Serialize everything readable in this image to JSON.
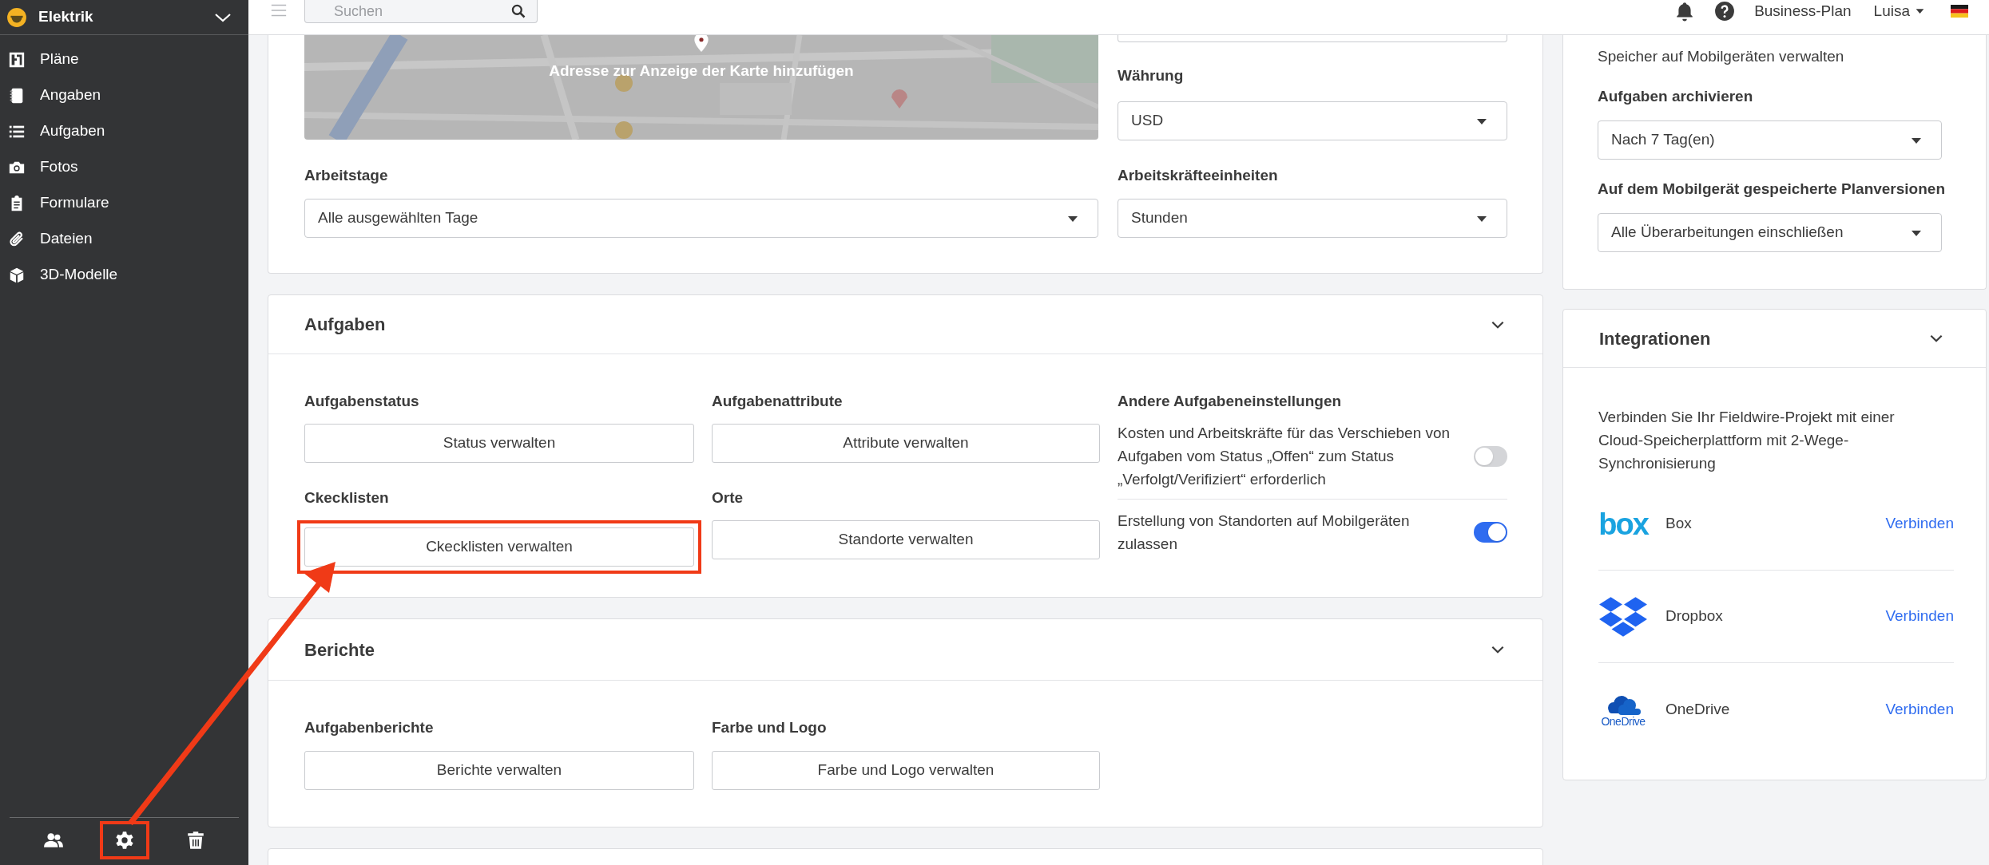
{
  "sidebar": {
    "project": "Elektrik",
    "items": [
      {
        "kind": "plans",
        "label": "Pläne"
      },
      {
        "kind": "specs",
        "label": "Angaben"
      },
      {
        "kind": "tasks",
        "label": "Aufgaben"
      },
      {
        "kind": "photos",
        "label": "Fotos"
      },
      {
        "kind": "forms",
        "label": "Formulare"
      },
      {
        "kind": "files",
        "label": "Dateien"
      },
      {
        "kind": "models",
        "label": "3D-Modelle"
      }
    ],
    "footer_buttons": [
      {
        "kind": "people",
        "highlighted": false
      },
      {
        "kind": "settings",
        "highlighted": true
      },
      {
        "kind": "trash",
        "highlighted": false
      }
    ]
  },
  "topbar": {
    "search": {
      "placeholder": "Suchen"
    },
    "plan": "Business-Plan",
    "user": "Luisa"
  },
  "project_card": {
    "map_caption": "Adresse zur Anzeige der Karte hinzufügen",
    "fields": [
      {
        "label": "Währung",
        "value": "USD"
      },
      {
        "label": "Arbeitstage",
        "value": "Alle ausgewählten Tage"
      },
      {
        "label": "Arbeitskräfteeinheiten",
        "value": "Stunden"
      }
    ]
  },
  "tasks": {
    "title": "Aufgaben",
    "groups": [
      {
        "label": "Aufgabenstatus",
        "button": "Status verwalten",
        "highlighted": false
      },
      {
        "label": "Aufgabenattribute",
        "button": "Attribute verwalten",
        "highlighted": false
      },
      {
        "label": "Ckecklisten",
        "button": "Ckecklisten verwalten",
        "highlighted": true
      },
      {
        "label": "Orte",
        "button": "Standorte verwalten",
        "highlighted": false
      }
    ],
    "other_settings": {
      "title": "Andere Aufgabeneinstellungen",
      "toggles": [
        {
          "label": "Kosten und Arbeitskräfte für das Verschieben von Aufgaben vom Status „Offen“ zum Status „Verfolgt/Verifiziert“ erforderlich",
          "on": false
        },
        {
          "label": "Erstellung von Standorten auf Mobilgeräten zulassen",
          "on": true
        }
      ]
    }
  },
  "reports": {
    "title": "Berichte",
    "groups": [
      {
        "label": "Aufgabenberichte",
        "button": "Berichte verwalten",
        "highlighted": false
      },
      {
        "label": "Farbe und Logo",
        "button": "Farbe und Logo verwalten",
        "highlighted": false
      }
    ]
  },
  "mobile_card": {
    "text": "Speicher auf Mobilgeräten verwalten",
    "fields": [
      {
        "label": "Aufgaben archivieren",
        "value": "Nach 7 Tag(en)"
      },
      {
        "label": "Auf dem Mobilgerät gespeicherte Planversionen",
        "value": "Alle Überarbeitungen einschließen"
      }
    ]
  },
  "integrations": {
    "title": "Integrationen",
    "description": "Verbinden Sie Ihr Fieldwire-Projekt mit einer Cloud-Speicherplattform mit 2-Wege-Synchronisierung",
    "services": [
      {
        "kind": "box",
        "logo_text": "box",
        "name": "Box",
        "action": "Verbinden"
      },
      {
        "kind": "dropbox",
        "name": "Dropbox",
        "action": "Verbinden"
      },
      {
        "kind": "onedrive",
        "logo_text": "OneDrive",
        "name": "OneDrive",
        "action": "Verbinden"
      }
    ]
  }
}
